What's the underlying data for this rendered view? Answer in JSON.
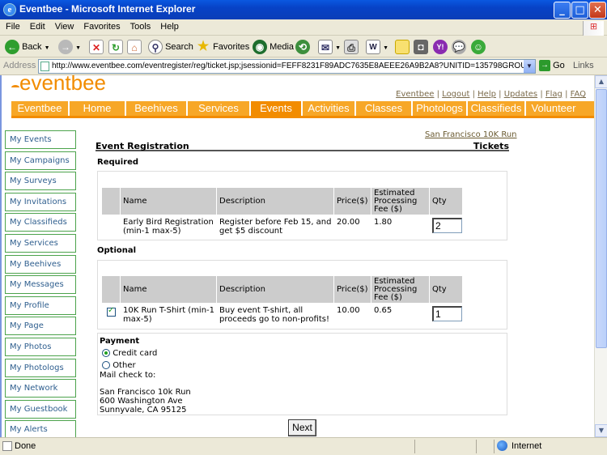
{
  "window": {
    "title": "Eventbee - Microsoft Internet Explorer",
    "minimize": "_",
    "maximize": "□",
    "close": "✕"
  },
  "menu": [
    "File",
    "Edit",
    "View",
    "Favorites",
    "Tools",
    "Help"
  ],
  "toolbar": {
    "back": "Back",
    "search": "Search",
    "favorites": "Favorites",
    "media": "Media"
  },
  "address": {
    "label": "Address",
    "url": "http://www.eventbee.com/eventregister/reg/ticket.jsp;jsessionid=FEFF8231F89ADC7635E8AEEE26A9B2A8?UNITID=135798GROU",
    "go": "Go",
    "links": "Links"
  },
  "site": {
    "logo": "eventbee",
    "toplinks": [
      "Eventbee",
      "Logout",
      "Help",
      "Updates",
      "Flag",
      "FAQ"
    ],
    "nav": [
      "Eventbee",
      "Home",
      "Beehives",
      "Services",
      "Events",
      "Activities",
      "Classes",
      "Photologs",
      "Classifieds",
      "Volunteer"
    ],
    "nav_active": "Events"
  },
  "sidebar": [
    "My Events",
    "My Campaigns",
    "My Surveys",
    "My Invitations",
    "My Classifieds",
    "My Services",
    "My Beehives",
    "My Messages",
    "My Profile",
    "My Page",
    "My Photos",
    "My Photologs",
    "My Network",
    "My Guestbook",
    "My Alerts"
  ],
  "registration": {
    "event_link": "San Francisco 10K Run",
    "heading": "Event Registration",
    "heading_right": "Tickets",
    "columns": {
      "name": "Name",
      "description": "Description",
      "price": "Price($)",
      "fee": "Estimated Processing Fee ($)",
      "qty": "Qty"
    },
    "required": {
      "label": "Required",
      "name": "Early Bird Registration (min-1 max-5)",
      "description": "Register before Feb 15, and get $5 discount",
      "price": "20.00",
      "fee": "1.80",
      "qty": "2"
    },
    "optional": {
      "label": "Optional",
      "checked": true,
      "name": "10K Run T-Shirt (min-1 max-5)",
      "description": "Buy event T-shirt, all proceeds go to non-profits!",
      "price": "10.00",
      "fee": "0.65",
      "qty": "1"
    },
    "payment": {
      "label": "Payment",
      "options": [
        "Credit card",
        "Other"
      ],
      "selected": "Credit card",
      "mail_label": "Mail check to:",
      "address_lines": [
        "San Francisco 10k Run",
        "600 Washington Ave",
        "Sunnyvale, CA 95125"
      ]
    },
    "next": "Next"
  },
  "status": {
    "text": "Done",
    "zone": "Internet"
  }
}
